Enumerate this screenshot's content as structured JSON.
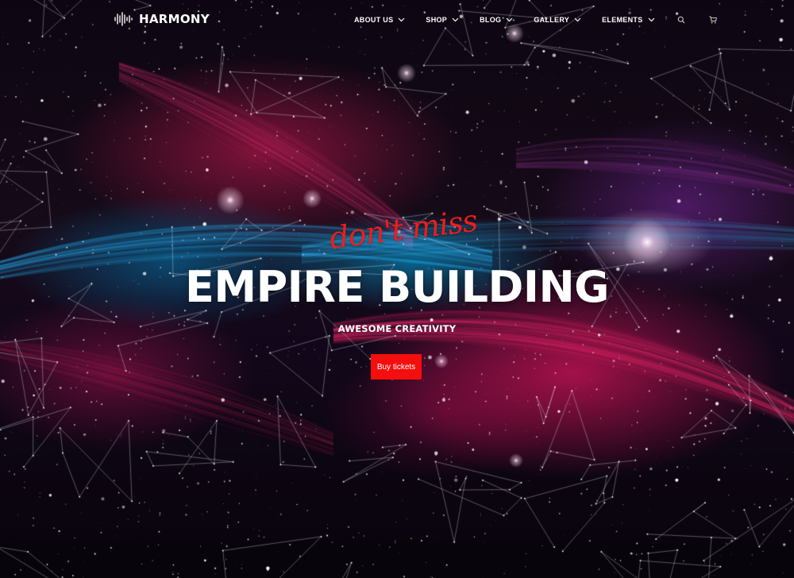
{
  "brand": {
    "name": "HARMONY",
    "logo_icon": "sound-wave-icon"
  },
  "nav": {
    "items": [
      {
        "label": "ABOUT US",
        "icon": "chevron-down-icon"
      },
      {
        "label": "SHOP",
        "icon": "chevron-down-icon"
      },
      {
        "label": "BLOG",
        "icon": "chevron-down-icon"
      },
      {
        "label": "GALLERY",
        "icon": "chevron-down-icon"
      },
      {
        "label": "ELEMENTS",
        "icon": "chevron-down-icon"
      }
    ],
    "search_icon": "search-icon",
    "cart_icon": "cart-icon"
  },
  "hero": {
    "script_text": "don't miss",
    "title": "EMPIRE BUILDING",
    "subtitle": "AWESOME CREATIVITY",
    "cta_label": "Buy tickets"
  },
  "colors": {
    "accent": "#f40e0e",
    "script_red": "#f01c1c",
    "text": "#ffffff",
    "background": "#0b0410"
  }
}
